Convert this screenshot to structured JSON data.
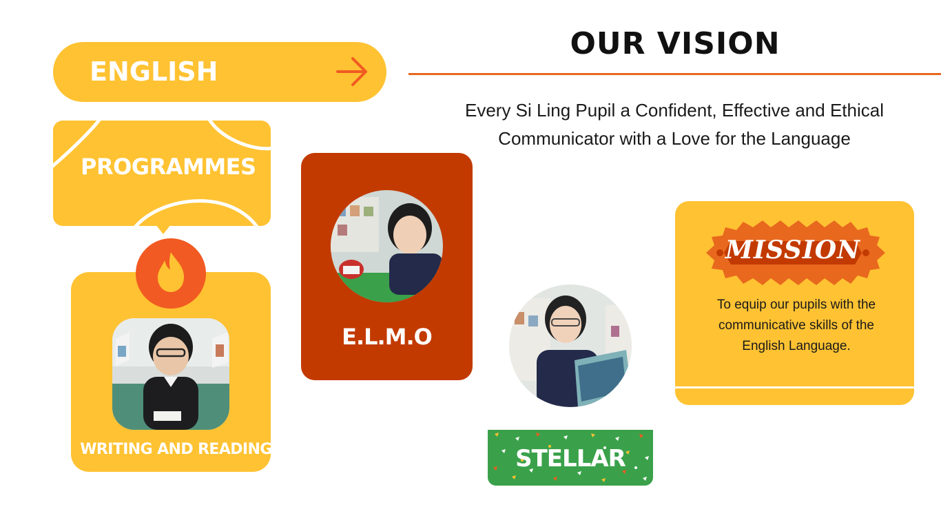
{
  "header": {
    "subject_label": "ENGLISH",
    "arrow_icon": "arrow-right-icon"
  },
  "programmes": {
    "label": "PROGRAMMES",
    "items": {
      "writing": {
        "label": "WRITING AND READING",
        "icon": "fire-icon"
      },
      "elmo": {
        "label": "E.L.M.O"
      },
      "stellar": {
        "label": "STELLAR"
      }
    }
  },
  "vision": {
    "title": "OUR VISION",
    "line1": "Every Si Ling Pupil a Confident, Effective and Ethical",
    "line2": "Communicator with a Love for the Language"
  },
  "mission": {
    "title": "MISSION",
    "line1": "To equip our pupils with the",
    "line2": "communicative skills of the",
    "line3": "English Language."
  },
  "colors": {
    "yellow": "#FFC232",
    "orange": "#F15A22",
    "rust": "#C23A00",
    "green": "#3AA14A",
    "accent_line": "#E8681E"
  }
}
